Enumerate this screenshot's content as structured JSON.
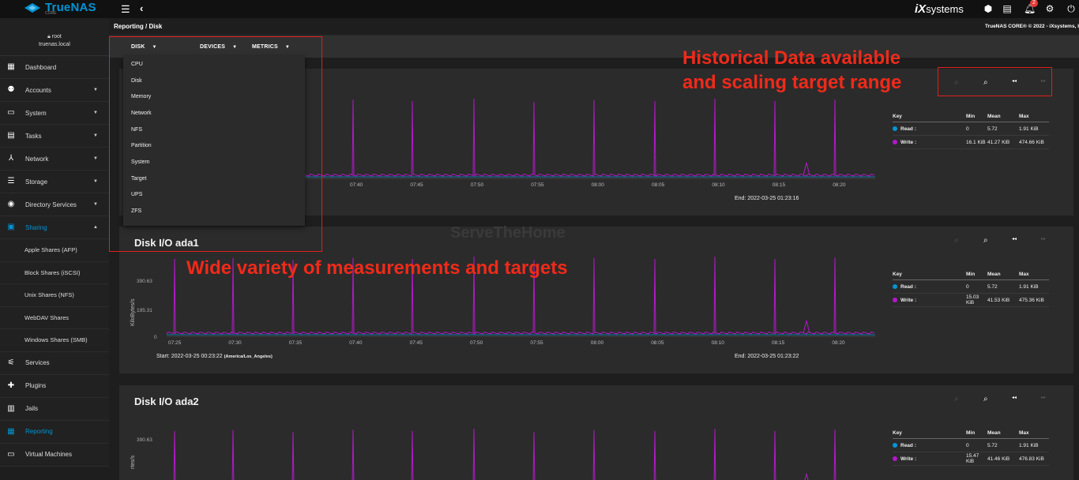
{
  "topbar": {
    "brand": "TrueNAS",
    "brand_sub": "CORE",
    "vendor": "systems",
    "vendor_mark": "iX",
    "notification_count": "2"
  },
  "user": {
    "name": "root",
    "host": "truenas.local"
  },
  "sidebar": [
    {
      "label": "Dashboard",
      "icon": "dashboard-icon",
      "glyph": "▦",
      "chev": ""
    },
    {
      "label": "Accounts",
      "icon": "people-icon",
      "glyph": "⚉",
      "chev": "▼"
    },
    {
      "label": "System",
      "icon": "laptop-icon",
      "glyph": "▭",
      "chev": "▼"
    },
    {
      "label": "Tasks",
      "icon": "calendar-icon",
      "glyph": "▤",
      "chev": "▼"
    },
    {
      "label": "Network",
      "icon": "network-icon",
      "glyph": "⅄",
      "chev": "▼"
    },
    {
      "label": "Storage",
      "icon": "storage-icon",
      "glyph": "☰",
      "chev": "▼"
    },
    {
      "label": "Directory Services",
      "icon": "directory-icon",
      "glyph": "◉",
      "chev": "▼"
    },
    {
      "label": "Sharing",
      "icon": "folder-shared-icon",
      "glyph": "▣",
      "chev": "▲",
      "active": true
    }
  ],
  "sharing_items": [
    "Apple Shares (AFP)",
    "Block Shares (iSCSI)",
    "Unix Shares (NFS)",
    "WebDAV Shares",
    "Windows Shares (SMB)"
  ],
  "sidebar_bottom": [
    {
      "label": "Services",
      "icon": "tune-icon",
      "glyph": "⚟"
    },
    {
      "label": "Plugins",
      "icon": "puzzle-icon",
      "glyph": "✚"
    },
    {
      "label": "Jails",
      "icon": "jail-icon",
      "glyph": "▥"
    },
    {
      "label": "Reporting",
      "icon": "chart-icon",
      "glyph": "▦",
      "active": true
    },
    {
      "label": "Virtual Machines",
      "icon": "monitor-icon",
      "glyph": "▭"
    }
  ],
  "breadcrumb": "Reporting  /  Disk",
  "copyright": "TrueNAS CORE® © 2022 - iXsystems, I",
  "toolbar": {
    "disk": "DISK",
    "devices": "DEVICES",
    "metrics": "METRICS"
  },
  "dropdown": [
    "CPU",
    "Disk",
    "Memory",
    "Network",
    "NFS",
    "Partition",
    "System",
    "Target",
    "UPS",
    "ZFS"
  ],
  "annotations": {
    "top": "Historical Data available\nand scaling target range",
    "middle": "Wide variety of measurements and targets"
  },
  "watermark": "ServeTheHome",
  "cards": [
    {
      "title": "",
      "yticks": [],
      "ylabel": "",
      "xticks": [
        "07:40",
        "07:45",
        "07:50",
        "07:55",
        "08:00",
        "08:05",
        "08:10",
        "08:15",
        "08:20"
      ],
      "start": "",
      "start_tz": "",
      "end": "2022-03-25 01:23:16",
      "legend": {
        "read": {
          "min": "0",
          "mean": "5.72",
          "max": "1.91 KiB"
        },
        "write": {
          "min": "16.1 KiB",
          "mean": "41.27 KiB",
          "max": "474.66 KiB"
        }
      }
    },
    {
      "title": "Disk I/O ada1",
      "yticks": [
        "390.63",
        "195.31",
        "0"
      ],
      "ylabel": "KiloBytes/s",
      "xticks": [
        "07:25",
        "07:30",
        "07:35",
        "07:40",
        "07:45",
        "07:50",
        "07:55",
        "08:00",
        "08:05",
        "08:10",
        "08:15",
        "08:20"
      ],
      "start": "2022-03-25 00:23:22",
      "start_tz": "(America/Los_Angeles)",
      "end": "2022-03-25 01:23:22",
      "legend": {
        "read": {
          "min": "0",
          "mean": "5.72",
          "max": "1.91 KiB"
        },
        "write": {
          "min": "15.03 KiB",
          "mean": "41.53 KiB",
          "max": "475.36 KiB"
        }
      }
    },
    {
      "title": "Disk I/O ada2",
      "yticks": [
        "390.63"
      ],
      "ylabel": "rtes/s",
      "xticks": [],
      "start": "",
      "start_tz": "",
      "end": "",
      "legend": {
        "read": {
          "min": "0",
          "mean": "5.72",
          "max": "1.91 KiB"
        },
        "write": {
          "min": "15.47 KiB",
          "mean": "41.46 KiB",
          "max": "476.83 KiB"
        }
      }
    }
  ],
  "legend_headers": {
    "key": "Key",
    "min": "Min",
    "mean": "Mean",
    "max": "Max",
    "read": "Read :",
    "write": "Write :"
  },
  "labels": {
    "start": "Start:",
    "end": "End:"
  },
  "colors": {
    "accent": "#0095d5",
    "read": "#0095d5",
    "write": "#b319c9",
    "annotation": "#f02a1a"
  }
}
